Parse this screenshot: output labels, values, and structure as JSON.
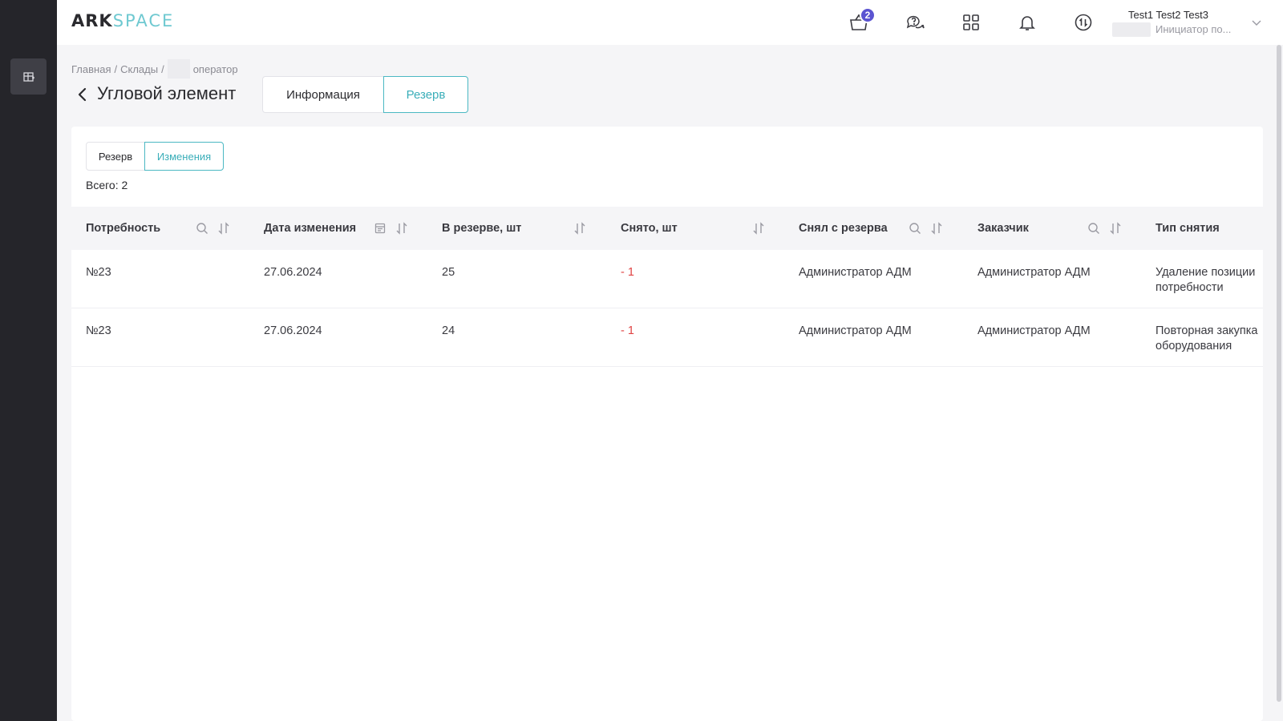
{
  "app": {
    "logo_ark": "ARK",
    "logo_space": "SPACE"
  },
  "header": {
    "cart_badge": "2",
    "user_name": "Test1 Test2 Test3",
    "user_role": "Инициатор по..."
  },
  "breadcrumb": {
    "items": [
      "Главная",
      "Склады"
    ],
    "separator": "/",
    "last": "оператор"
  },
  "page": {
    "title": "Угловой элемент"
  },
  "main_tabs": [
    {
      "label": "Информация",
      "active": false
    },
    {
      "label": "Резерв",
      "active": true
    }
  ],
  "sub_tabs": [
    {
      "label": "Резерв",
      "active": false
    },
    {
      "label": "Изменения",
      "active": true
    }
  ],
  "table": {
    "total_label": "Всего: 2",
    "columns": [
      "Потребность",
      "Дата изменения",
      "В резерве, шт",
      "Снято, шт",
      "Снял с резерва",
      "Заказчик",
      "Тип снятия"
    ],
    "rows": [
      {
        "need": "№23",
        "date": "27.06.2024",
        "reserved": "25",
        "removed": "- 1",
        "removed_by": "Администратор АДМ",
        "customer": "Администратор АДМ",
        "type_line1": "Удаление позиции",
        "type_line2": "потребности"
      },
      {
        "need": "№23",
        "date": "27.06.2024",
        "reserved": "24",
        "removed": "- 1",
        "removed_by": "Администратор АДМ",
        "customer": "Администратор АДМ",
        "type_line1": "Повторная закупка",
        "type_line2": "оборудования"
      }
    ]
  },
  "colors": {
    "accent": "#3aaeb9",
    "sidebar": "#25252a",
    "negative": "#e04444",
    "badge": "#5b54d1"
  }
}
